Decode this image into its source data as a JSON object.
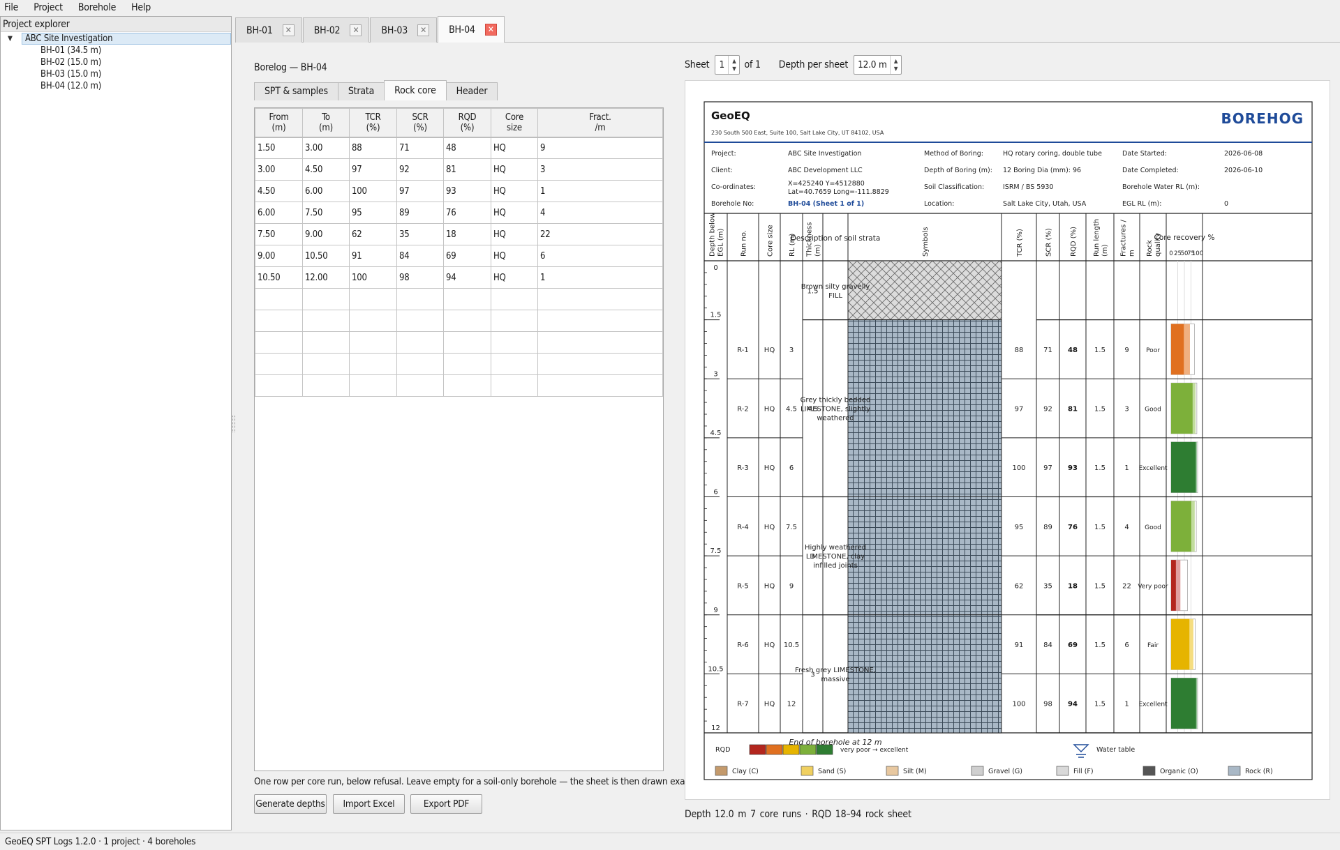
{
  "menu": [
    "File",
    "Project",
    "Borehole",
    "Help"
  ],
  "explorer": {
    "title": "Project explorer",
    "project": "ABC Site Investigation",
    "boreholes": [
      "BH-01 (34.5 m)",
      "BH-02 (15.0 m)",
      "BH-03 (15.0 m)",
      "BH-04 (12.0 m)"
    ]
  },
  "tabs": [
    {
      "label": "BH-01",
      "active": false
    },
    {
      "label": "BH-02",
      "active": false
    },
    {
      "label": "BH-03",
      "active": false
    },
    {
      "label": "BH-04",
      "active": true
    }
  ],
  "editor": {
    "title": "Borelog — BH-04",
    "subtabs": [
      "SPT & samples",
      "Strata",
      "Rock core",
      "Header"
    ],
    "active_subtab": "Rock core",
    "columns": [
      "From\n(m)",
      "To\n(m)",
      "TCR\n(%)",
      "SCR\n(%)",
      "RQD\n(%)",
      "Core\nsize",
      "Fract.\n/m"
    ],
    "rows": [
      [
        "1.50",
        "3.00",
        "88",
        "71",
        "48",
        "HQ",
        "9"
      ],
      [
        "3.00",
        "4.50",
        "97",
        "92",
        "81",
        "HQ",
        "3"
      ],
      [
        "4.50",
        "6.00",
        "100",
        "97",
        "93",
        "HQ",
        "1"
      ],
      [
        "6.00",
        "7.50",
        "95",
        "89",
        "76",
        "HQ",
        "4"
      ],
      [
        "7.50",
        "9.00",
        "62",
        "35",
        "18",
        "HQ",
        "22"
      ],
      [
        "9.00",
        "10.50",
        "91",
        "84",
        "69",
        "HQ",
        "6"
      ],
      [
        "10.50",
        "12.00",
        "100",
        "98",
        "94",
        "HQ",
        "1"
      ]
    ],
    "empty_rows": 5,
    "hint": "One row per core run, below refusal. Leave empty for a soil-only borehole — the sheet is then drawn exactly as before.",
    "buttons": [
      "Generate depths",
      "Import Excel",
      "Export PDF"
    ]
  },
  "sheet_controls": {
    "sheet_label": "Sheet",
    "sheet_value": "1",
    "of_label": "of 1",
    "depth_label": "Depth per sheet",
    "depth_value": "12.0 m"
  },
  "preview_status": "Depth 12.0 m    7 core runs · RQD 18–94    rock sheet",
  "statusbar": "GeoEQ SPT Logs 1.2.0 · 1 project · 4 boreholes",
  "borelog": {
    "company": "GeoEQ",
    "address": "230 South 500 East, Suite 100, Salt Lake City, UT 84102, USA",
    "heading": "BOREHOG",
    "info": [
      {
        "label": "Project:",
        "value": "ABC Site Investigation"
      },
      {
        "label": "Client:",
        "value": "ABC Development LLC"
      },
      {
        "label": "Co-ordinates:",
        "value": "X=425240 Y=4512880",
        "value2": "Lat=40.7659 Long=-111.8829"
      },
      {
        "label": "Borehole No:",
        "value": "BH-04 (Sheet 1 of 1)"
      },
      {
        "label": "Method of Boring:",
        "value": "HQ rotary coring, double tube"
      },
      {
        "label": "Depth of Boring (m):",
        "value": "12   Boring Dia (mm): 96"
      },
      {
        "label": "Soil Classification:",
        "value": "ISRM / BS 5930"
      },
      {
        "label": "Location:",
        "value": "Salt Lake City, Utah, USA"
      },
      {
        "label": "Date Started:",
        "value": "2026-06-08"
      },
      {
        "label": "Date Completed:",
        "value": "2026-06-10"
      },
      {
        "label": "Borehole Water RL (m):",
        "value": ""
      },
      {
        "label": "EGL RL (m):",
        "value": "0"
      }
    ],
    "col_headers": [
      "Depth below EGL (m)",
      "Run no.",
      "Core size",
      "RL (m)",
      "Thickness (m)",
      "Description of soil strata",
      "Symbols",
      "TCR (%)",
      "SCR (%)",
      "RQD (%)",
      "Run length (m)",
      "Fractures / m",
      "Rock quality",
      "Core recovery %"
    ],
    "recovery_ticks": [
      "0",
      "25",
      "50",
      "75",
      "100"
    ],
    "depth_labels": [
      "0",
      "1.5",
      "3",
      "4.5",
      "6",
      "7.5",
      "9",
      "10.5",
      "12"
    ],
    "strata": [
      {
        "from": 0,
        "to": 1.5,
        "thickness": "1.5",
        "description": "Brown silty gravelly FILL",
        "symbol": "fill"
      },
      {
        "from": 1.5,
        "to": 6,
        "thickness": "4.5",
        "description": "Grey thickly bedded LIMESTONE, slightly weathered",
        "symbol": "rock"
      },
      {
        "from": 6,
        "to": 9,
        "thickness": "3",
        "description": "Highly weathered LIMESTONE, clay infilled joints",
        "symbol": "rock"
      },
      {
        "from": 9,
        "to": 12,
        "thickness": "3",
        "description": "Fresh grey LIMESTONE, massive",
        "symbol": "rock"
      }
    ],
    "runs": [
      {
        "run": "R-1",
        "size": "HQ",
        "rl": "3",
        "tcr": 88,
        "scr": 71,
        "rqd": 48,
        "len": "1.5",
        "frac": "9",
        "quality": "Poor",
        "color": "#e07020",
        "light": "#f0b080"
      },
      {
        "run": "R-2",
        "size": "HQ",
        "rl": "4.5",
        "tcr": 97,
        "scr": 92,
        "rqd": 81,
        "len": "1.5",
        "frac": "3",
        "quality": "Good",
        "color": "#7db03a",
        "light": "#c2dc9e"
      },
      {
        "run": "R-3",
        "size": "HQ",
        "rl": "6",
        "tcr": 100,
        "scr": 97,
        "rqd": 93,
        "len": "1.5",
        "frac": "1",
        "quality": "Excellent",
        "color": "#2e7d32",
        "light": "#8fbf92"
      },
      {
        "run": "R-4",
        "size": "HQ",
        "rl": "7.5",
        "tcr": 95,
        "scr": 89,
        "rqd": 76,
        "len": "1.5",
        "frac": "4",
        "quality": "Good",
        "color": "#7db03a",
        "light": "#c2dc9e"
      },
      {
        "run": "R-5",
        "size": "HQ",
        "rl": "9",
        "tcr": 62,
        "scr": 35,
        "rqd": 18,
        "len": "1.5",
        "frac": "22",
        "quality": "Very poor",
        "color": "#b3261e",
        "light": "#e0a0a0"
      },
      {
        "run": "R-6",
        "size": "HQ",
        "rl": "10.5",
        "tcr": 91,
        "scr": 84,
        "rqd": 69,
        "len": "1.5",
        "frac": "6",
        "quality": "Fair",
        "color": "#e6b400",
        "light": "#f5dd80"
      },
      {
        "run": "R-7",
        "size": "HQ",
        "rl": "12",
        "tcr": 100,
        "scr": 98,
        "rqd": 94,
        "len": "1.5",
        "frac": "1",
        "quality": "Excellent",
        "color": "#2e7d32",
        "light": "#8fbf92"
      }
    ],
    "end_text": "End of borehole at 12 m",
    "legend": {
      "rqd_label": "RQD",
      "rqd_colors": [
        "#b3261e",
        "#e07020",
        "#e6b400",
        "#7db03a",
        "#2e7d32"
      ],
      "rqd_range": "very poor → excellent",
      "water_table": "Water table",
      "soils": [
        {
          "label": "Clay (C)",
          "color": "#c49a6c"
        },
        {
          "label": "Sand (S)",
          "color": "#f0d060"
        },
        {
          "label": "Silt (M)",
          "color": "#e8c8a0"
        },
        {
          "label": "Gravel (G)",
          "color": "#cfcfcf"
        },
        {
          "label": "Fill (F)",
          "color": "#d9d9d9"
        },
        {
          "label": "Organic (O)",
          "color": "#555555"
        },
        {
          "label": "Rock (R)",
          "color": "#a9b8c6"
        }
      ]
    }
  }
}
